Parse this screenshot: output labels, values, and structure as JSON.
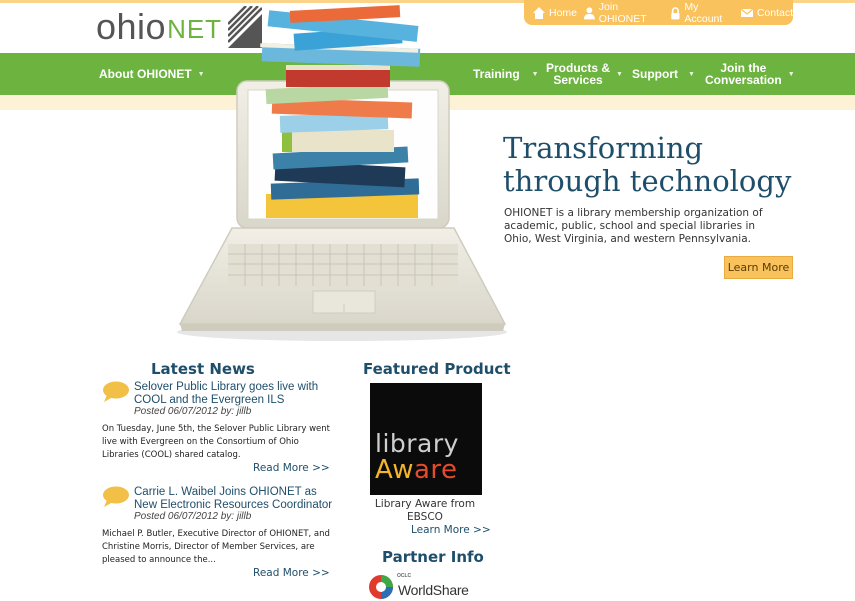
{
  "logo": {
    "ohio": "ohio",
    "net": "NET",
    "alt_text": "ohioNET"
  },
  "utility": {
    "items": [
      {
        "label": "Home",
        "icon": "home-icon"
      },
      {
        "label": "Join OHIONET",
        "icon": "user-icon"
      },
      {
        "label": "My Account",
        "icon": "lock-icon"
      },
      {
        "label": "Contact",
        "icon": "envelope-icon"
      }
    ]
  },
  "nav": {
    "about": "About OHIONET",
    "training": "Training",
    "products_line1": "Products &",
    "products_line2": "Services",
    "support": "Support",
    "join_line1": "Join the",
    "join_line2": "Conversation"
  },
  "hero": {
    "title_line1": "Transforming",
    "title_line2": "through technology",
    "text": "OHIONET is a library membership organization of academic, public, school and special libraries in Ohio, West Virginia, and western Pennsylvania.",
    "button": "Learn More"
  },
  "news": {
    "heading": "Latest News",
    "items": [
      {
        "title": "Selover Public Library goes live with COOL and the Evergreen ILS",
        "meta": "Posted 06/07/2012   by: jillb",
        "body": "On Tuesday, June 5th, the Selover Public Library went live with Evergreen on the Consortium of Ohio Libraries (COOL) shared catalog.",
        "more": "Read More >>"
      },
      {
        "title": "Carrie L. Waibel Joins OHIONET as New Electronic Resources Coordinator",
        "meta": "Posted 06/07/2012   by: jillb",
        "body": "Michael P. Butler, Executive Director of OHIONET, and Christine Morris, Director of Member Services, are pleased to announce the...",
        "more": "Read More >>"
      }
    ]
  },
  "featured": {
    "heading": "Featured Product",
    "image_word1": "library",
    "image_word2a": "Aw",
    "image_word2b": "are",
    "caption": "Library Aware from EBSCO",
    "more": "Learn More >>"
  },
  "partner": {
    "heading": "Partner Info",
    "oclc": "OCLC",
    "name": "WorldShare"
  },
  "colors": {
    "green": "#6db33f",
    "yellow": "#f9c25d",
    "navy": "#1f4e6b",
    "cream": "#fdf1d6"
  }
}
